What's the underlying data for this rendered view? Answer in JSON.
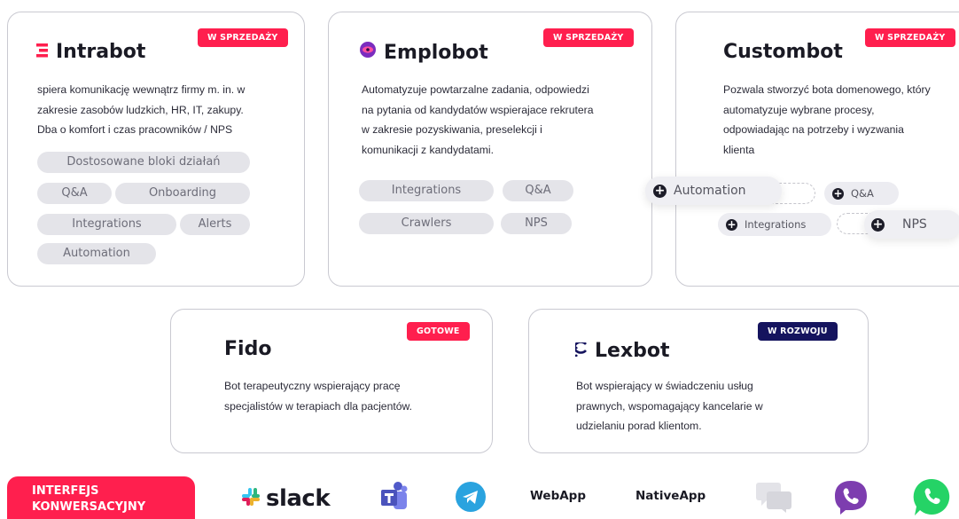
{
  "cards": {
    "intrabot": {
      "badge": "W SPRZEDAŻY",
      "title": "Intrabot",
      "description_lines": [
        "spiera komunikację wewnątrz firmy m. in. w",
        "zakresie zasobów ludzkich, HR, IT, zakupy.",
        "Dba o komfort i czas pracowników / NPS"
      ],
      "chips": [
        "Dostosowane bloki działań",
        "Q&A",
        "Onboarding",
        "Integrations",
        "Alerts",
        "Automation"
      ]
    },
    "emplobot": {
      "badge": "W SPRZEDAŻY",
      "title": "Emplobot",
      "description_lines": [
        "Automatyzuje powtarzalne zadania, odpowiedzi",
        "na pytania od kandydatów wspierajace rekrutera",
        "w zakresie pozyskiwania, preselekcji i",
        "komunikacji z kandydatami."
      ],
      "chips": [
        "Integrations",
        "Q&A",
        "Crawlers",
        "NPS"
      ]
    },
    "custombot": {
      "badge": "W SPRZEDAŻY",
      "title": "Custombot",
      "description_lines": [
        "Pozwala stworzyć bota domenowego, który",
        "automatyzuje wybrane procesy,",
        "odpowiadając na potrzeby i wyzwania",
        "klienta"
      ],
      "chips": [
        "Automation",
        "Q&A",
        "Integrations",
        "NPS"
      ]
    },
    "fido": {
      "badge": "GOTOWE",
      "title": "Fido",
      "description_lines": [
        "Bot terapeutyczny wspierający pracę",
        "specjalistów w terapiach dla pacjentów."
      ]
    },
    "lexbot": {
      "badge": "W ROZWOJU",
      "title": "Lexbot",
      "description_lines": [
        "Bot wspierający w świadczeniu usług",
        "prawnych, wspomagający kancelarie w",
        "udzielaniu porad klientom."
      ]
    }
  },
  "footer": {
    "label_lines": [
      "INTERFEJS",
      "KONWERSACYJNY"
    ],
    "channels": {
      "slack": "slack",
      "webapp": "WebApp",
      "nativeapp": "NativeApp"
    }
  },
  "colors": {
    "accent_red": "#ff1f4e",
    "navy": "#15145e",
    "chip_bg": "#e4e4e9",
    "emplobot_icon": "#7b2cbf",
    "telegram": "#2aa3df",
    "viber": "#7d3daf",
    "whatsapp": "#25d366",
    "teams": "#5059c9"
  },
  "icons": [
    "intrabot-logo-icon",
    "emplobot-logo-icon",
    "lexbot-logo-icon",
    "plus-icon",
    "slack-icon",
    "teams-icon",
    "telegram-icon",
    "chat-icon",
    "viber-icon",
    "whatsapp-icon"
  ]
}
